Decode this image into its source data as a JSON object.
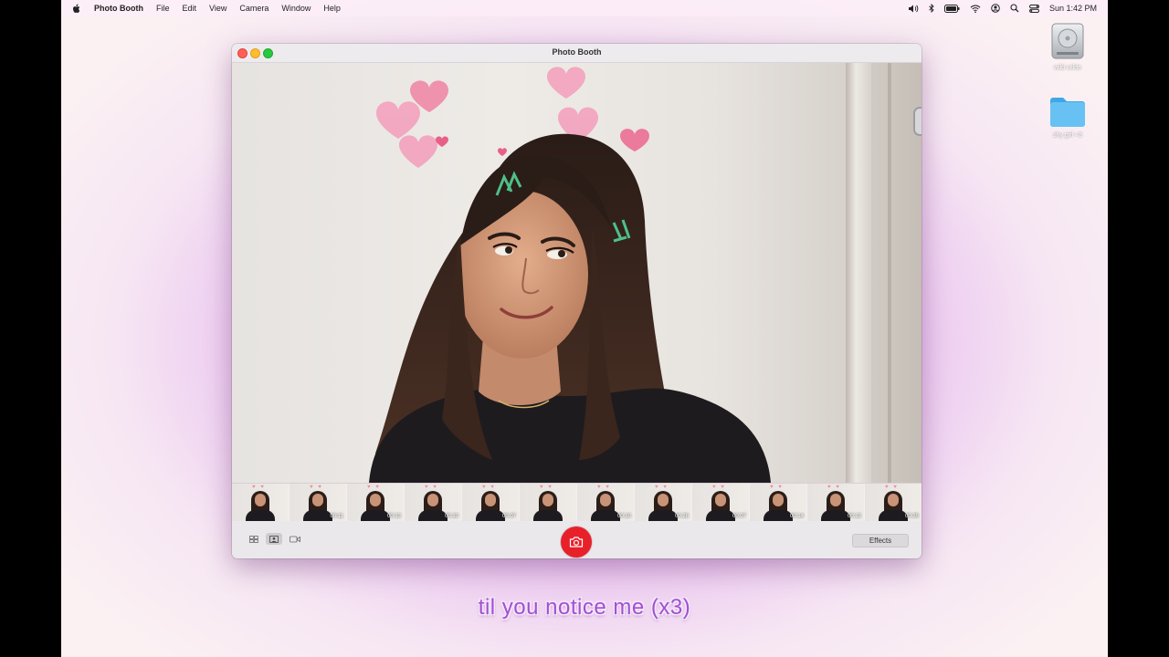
{
  "menubar": {
    "app_name": "Photo Booth",
    "items": [
      "File",
      "Edit",
      "View",
      "Camera",
      "Window",
      "Help"
    ],
    "clock": "Sun 1:42 PM",
    "status_icons": [
      "volume-icon",
      "bluetooth-icon",
      "battery-icon",
      "wifi-icon",
      "user-icon",
      "spotlight-icon",
      "control-center-icon"
    ]
  },
  "desktop": {
    "icons": [
      {
        "label": "wild wilde",
        "icon": "hard-drive-icon"
      },
      {
        "label": "shy girl <3",
        "icon": "folder-icon"
      }
    ]
  },
  "window": {
    "title": "Photo Booth",
    "filmstrip": {
      "durations": [
        "",
        "00:11",
        "00:13",
        "00:10",
        "00:07",
        "",
        "00:10",
        "00:26",
        "00:07",
        "00:14",
        "00:13",
        "00:35"
      ]
    },
    "toolbar": {
      "view_buttons": [
        "grid-view-icon",
        "single-photo-icon",
        "video-icon"
      ],
      "effects_label": "Effects"
    }
  },
  "caption": "til you notice me (x3)",
  "colors": {
    "shutter": "#e8202a",
    "caption": "#a34fd1",
    "desktop_glow": "#d995e8"
  }
}
